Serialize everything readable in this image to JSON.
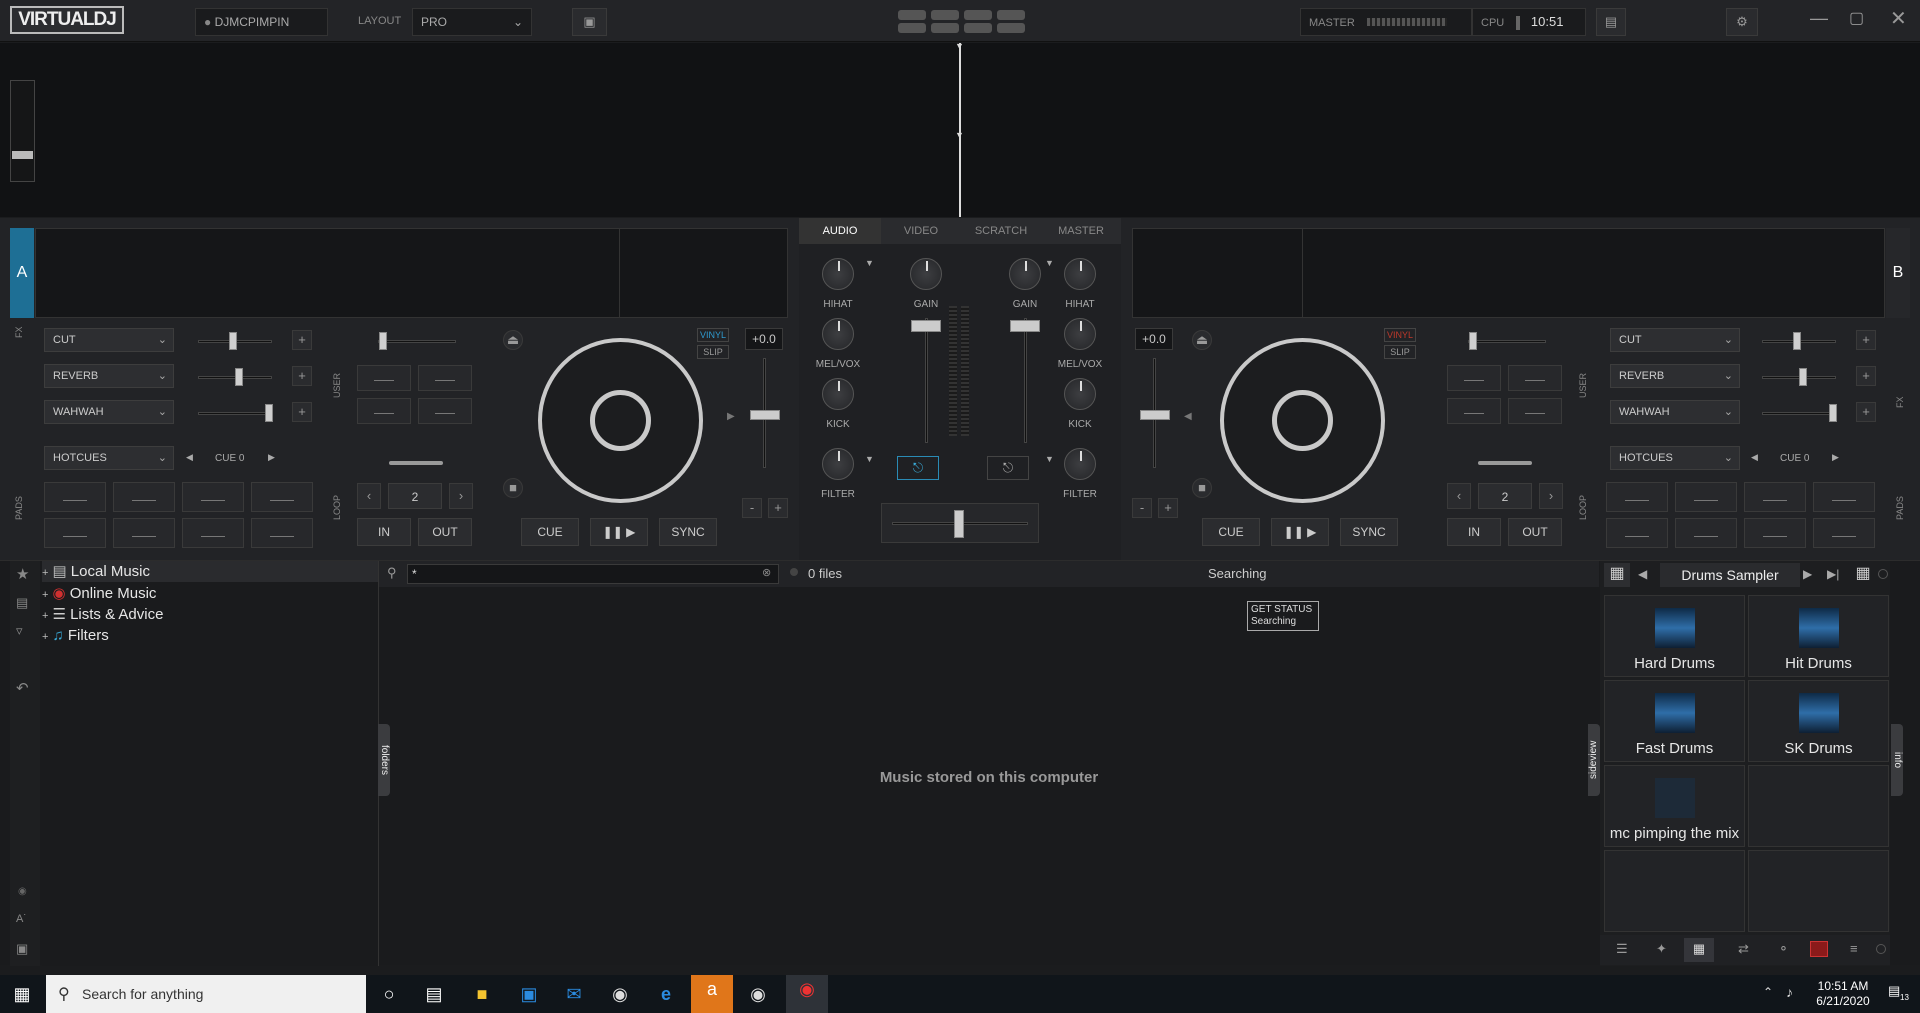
{
  "topbar": {
    "logo": "VIRTUALDJ",
    "user": "DJMCPIMPIN",
    "layout_label": "LAYOUT",
    "layout_value": "PRO",
    "master_label": "MASTER",
    "cpu_label": "CPU",
    "clock": "10:51 AM"
  },
  "mixer": {
    "tabs": [
      "AUDIO",
      "VIDEO",
      "SCRATCH",
      "MASTER"
    ],
    "hihat": "HIHAT",
    "gain": "GAIN",
    "melvox": "MEL/VOX",
    "kick": "KICK",
    "filter": "FILTER"
  },
  "deckA": {
    "letter": "A",
    "fx": [
      "CUT",
      "REVERB",
      "WAHWAH"
    ],
    "fx_label": "FX",
    "user_label": "USER",
    "pads_label": "PADS",
    "loop_label": "LOOP",
    "pads_mode": "HOTCUES",
    "cue_label": "CUE 0",
    "loop_value": "2",
    "in": "IN",
    "out": "OUT",
    "vinyl": "VINYL",
    "slip": "SLIP",
    "pitch": "+0.0",
    "cue": "CUE",
    "play": "❚❚ ▶",
    "sync": "SYNC",
    "minus": "-",
    "plus": "+"
  },
  "deckB": {
    "letter": "B",
    "fx": [
      "CUT",
      "REVERB",
      "WAHWAH"
    ],
    "fx_label": "FX",
    "user_label": "USER",
    "pads_label": "PADS",
    "loop_label": "LOOP",
    "pads_mode": "HOTCUES",
    "cue_label": "CUE 0",
    "loop_value": "2",
    "in": "IN",
    "out": "OUT",
    "vinyl": "VINYL",
    "slip": "SLIP",
    "pitch": "+0.0",
    "cue": "CUE",
    "play": "❚❚ ▶",
    "sync": "SYNC",
    "minus": "-",
    "plus": "+"
  },
  "browser": {
    "tree": [
      "Local Music",
      "Online Music",
      "Lists & Advice",
      "Filters"
    ],
    "search_value": "*",
    "file_count": "0 files",
    "status": "Searching",
    "tooltip_title": "GET STATUS",
    "tooltip_text": "Searching",
    "empty_message": "Music stored on this computer",
    "folders_tab": "folders",
    "sideview_tab": "sideview",
    "info_tab": "info"
  },
  "sampler": {
    "bank": "Drums Sampler",
    "cells": [
      "Hard Drums",
      "Hit Drums",
      "Fast Drums",
      "SK Drums",
      "mc pimping the mix",
      "",
      "",
      ""
    ]
  },
  "taskbar": {
    "search_placeholder": "Search for anything",
    "time": "10:51 AM",
    "date": "6/21/2020",
    "notif_count": "13"
  }
}
